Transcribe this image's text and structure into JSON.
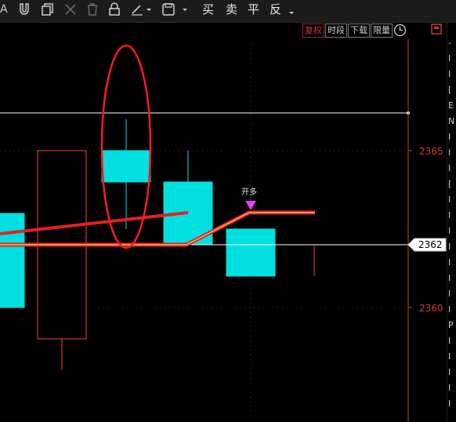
{
  "toolbar": {
    "edge_label": "A",
    "trade_buttons": [
      "买",
      "卖",
      "平",
      "反"
    ]
  },
  "period_tabs": [
    {
      "label": "复权",
      "active": true
    },
    {
      "label": "时段",
      "active": false
    },
    {
      "label": "下载",
      "active": false
    },
    {
      "label": "限量",
      "active": false
    }
  ],
  "chart_data": {
    "type": "candlestick",
    "y_ticks": [
      2365,
      2360
    ],
    "ylim": [
      2358.6,
      2366.2
    ],
    "current_price_label": "2362",
    "reference_line_value": 2366.2,
    "current_price_value": 2362.0,
    "candles": [
      {
        "open": 2360.0,
        "close": 2363.0,
        "high": 2363.0,
        "low": 2360.0,
        "color": "#00e0e0",
        "filled": true
      },
      {
        "open": 2359.0,
        "close": 2365.0,
        "high": 2365.0,
        "low": 2358.0,
        "color": "#ff3c3c",
        "filled": false
      },
      {
        "open": 2365.0,
        "close": 2364.0,
        "high": 2366.0,
        "low": 2362.5,
        "color": "#00e0e0",
        "filled": true
      },
      {
        "open": 2364.0,
        "close": 2362.0,
        "high": 2365.0,
        "low": 2362.0,
        "color": "#00e0e0",
        "filled": true
      },
      {
        "open": 2362.5,
        "close": 2361.0,
        "high": 2362.5,
        "low": 2361.0,
        "color": "#00e0e0",
        "filled": true
      },
      {
        "open": 2362.0,
        "close": 2362.0,
        "high": 2362.0,
        "low": 2361.0,
        "color": "#ff3c3c",
        "filled": false
      }
    ],
    "signal_label": "开多",
    "colors": {
      "up": "#ff3c3c",
      "down": "#00e0e0",
      "axis": "#d23a3a",
      "marker": "#e040fb",
      "line": "#ffffff"
    }
  },
  "right_panel": {
    "chars": [
      "-",
      "I",
      "I",
      "[",
      "E",
      "N",
      "I",
      "I",
      "I",
      "[",
      "I",
      "I",
      "I",
      "I",
      "I",
      "I",
      "I",
      "I",
      "P",
      "I",
      "I",
      "I",
      "I",
      "I"
    ]
  }
}
